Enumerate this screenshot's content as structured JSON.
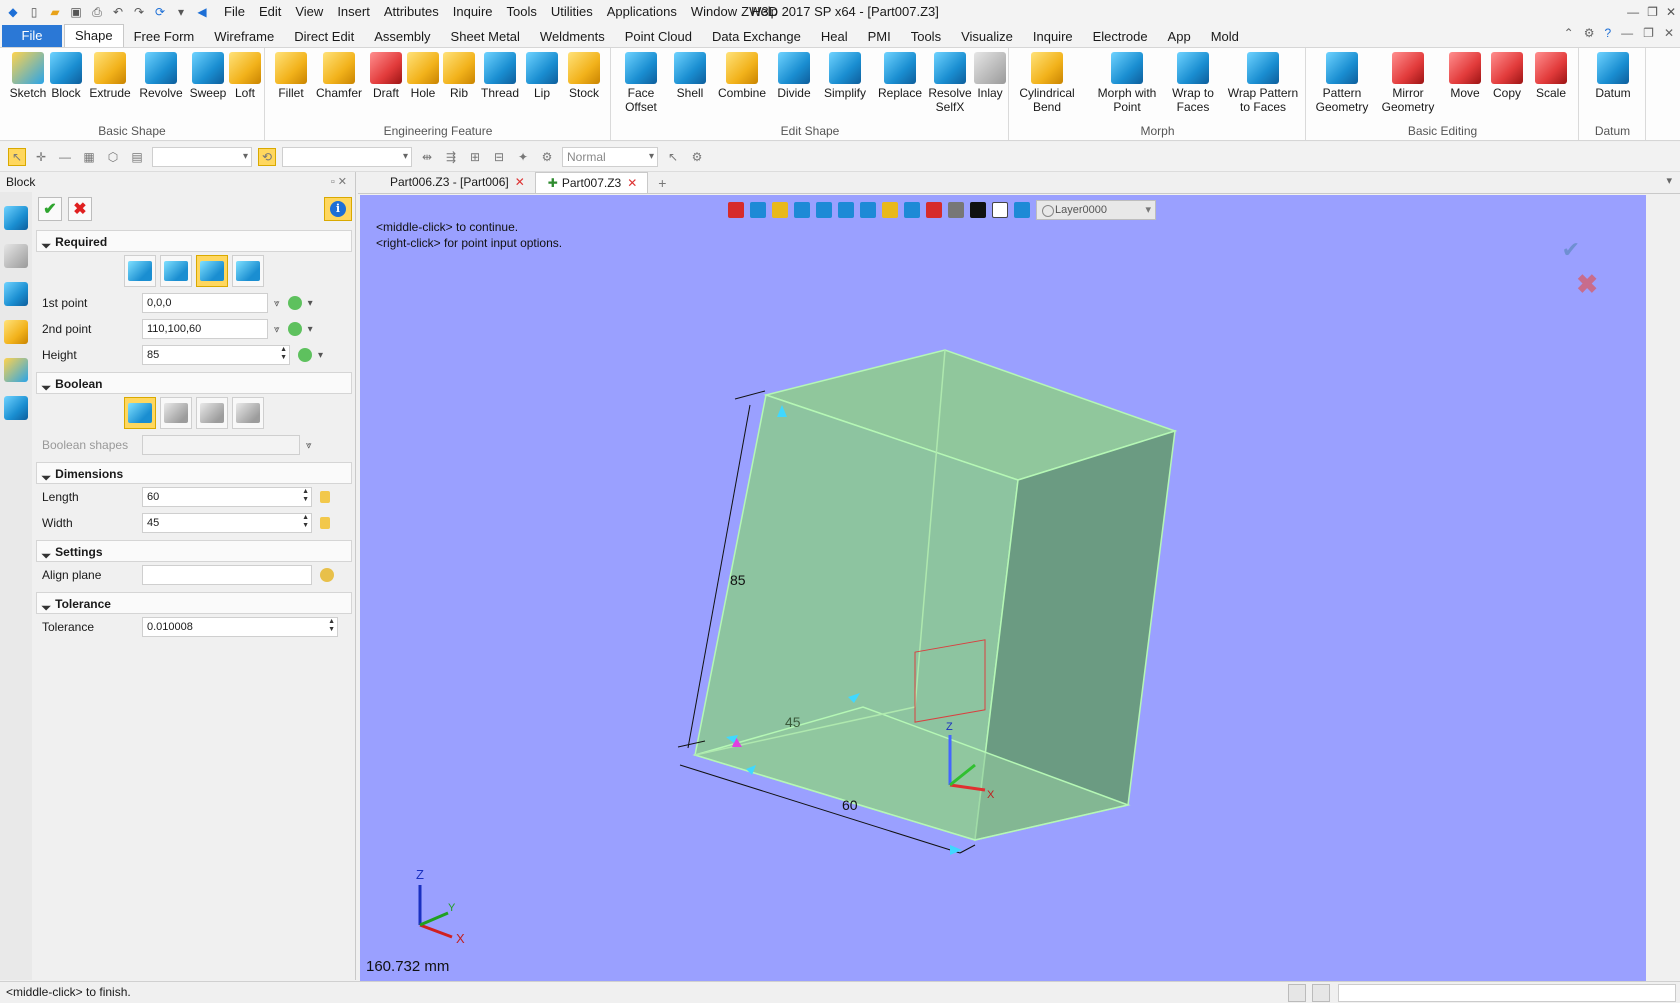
{
  "app": {
    "title": "ZW3D 2017 SP x64 - [Part007.Z3]",
    "menu": [
      "File",
      "Edit",
      "View",
      "Insert",
      "Attributes",
      "Inquire",
      "Tools",
      "Utilities",
      "Applications",
      "Window",
      "Help"
    ]
  },
  "ribbon_tabs": [
    "File",
    "Shape",
    "Free Form",
    "Wireframe",
    "Direct Edit",
    "Assembly",
    "Sheet Metal",
    "Weldments",
    "Point Cloud",
    "Data Exchange",
    "Heal",
    "PMI",
    "Tools",
    "Visualize",
    "Inquire",
    "Electrode",
    "App",
    "Mold"
  ],
  "active_ribbon_tab": "Shape",
  "ribbon_groups": {
    "basic_shape": {
      "label": "Basic Shape",
      "buttons": [
        "Sketch",
        "Block",
        "Extrude",
        "Revolve",
        "Sweep",
        "Loft"
      ]
    },
    "engineering_feature": {
      "label": "Engineering Feature",
      "buttons": [
        "Fillet",
        "Chamfer",
        "Draft",
        "Hole",
        "Rib",
        "Thread",
        "Lip",
        "Stock"
      ]
    },
    "edit_shape": {
      "label": "Edit Shape",
      "buttons": [
        "Face Offset",
        "Shell",
        "Combine",
        "Divide",
        "Simplify",
        "Replace",
        "Resolve SelfX",
        "Inlay"
      ]
    },
    "morph": {
      "label": "Morph",
      "buttons": [
        "Cylindrical Bend",
        "Morph with Point",
        "Wrap to Faces",
        "Wrap Pattern to Faces"
      ]
    },
    "basic_editing": {
      "label": "Basic Editing",
      "buttons": [
        "Pattern Geometry",
        "Mirror Geometry",
        "Move",
        "Copy",
        "Scale"
      ]
    },
    "datum": {
      "label": "Datum",
      "buttons": [
        "Datum"
      ]
    }
  },
  "toolbar2": {
    "render_mode": "Normal"
  },
  "left_panel": {
    "title": "Block",
    "sections": {
      "required": "Required",
      "boolean": "Boolean",
      "dimensions": "Dimensions",
      "settings": "Settings",
      "tolerance": "Tolerance"
    },
    "fields": {
      "first_point": {
        "label": "1st point",
        "value": "0,0,0"
      },
      "second_point": {
        "label": "2nd point",
        "value": "110,100,60"
      },
      "height": {
        "label": "Height",
        "value": "85"
      },
      "boolean_shapes": {
        "label": "Boolean shapes",
        "value": ""
      },
      "length": {
        "label": "Length",
        "value": "60"
      },
      "width": {
        "label": "Width",
        "value": "45"
      },
      "align_plane": {
        "label": "Align plane",
        "value": ""
      },
      "tolerance": {
        "label": "Tolerance",
        "value": "0.010008"
      }
    }
  },
  "doc_tabs": [
    {
      "label": "Part006.Z3 - [Part006]",
      "active": false
    },
    {
      "label": "Part007.Z3",
      "active": true
    }
  ],
  "viewport": {
    "hint_line1": "<middle-click> to continue.",
    "hint_line2": "<right-click> for point input options.",
    "layer": "Layer0000",
    "measure": "160.732 mm",
    "dim_height": "85",
    "dim_width": "45",
    "dim_length": "60",
    "axis_x": "X",
    "axis_y": "Y",
    "axis_z": "Z",
    "background_color": "#9aa0ff",
    "solid_color": "#8cc39c"
  },
  "status": {
    "message": "<middle-click> to finish."
  }
}
